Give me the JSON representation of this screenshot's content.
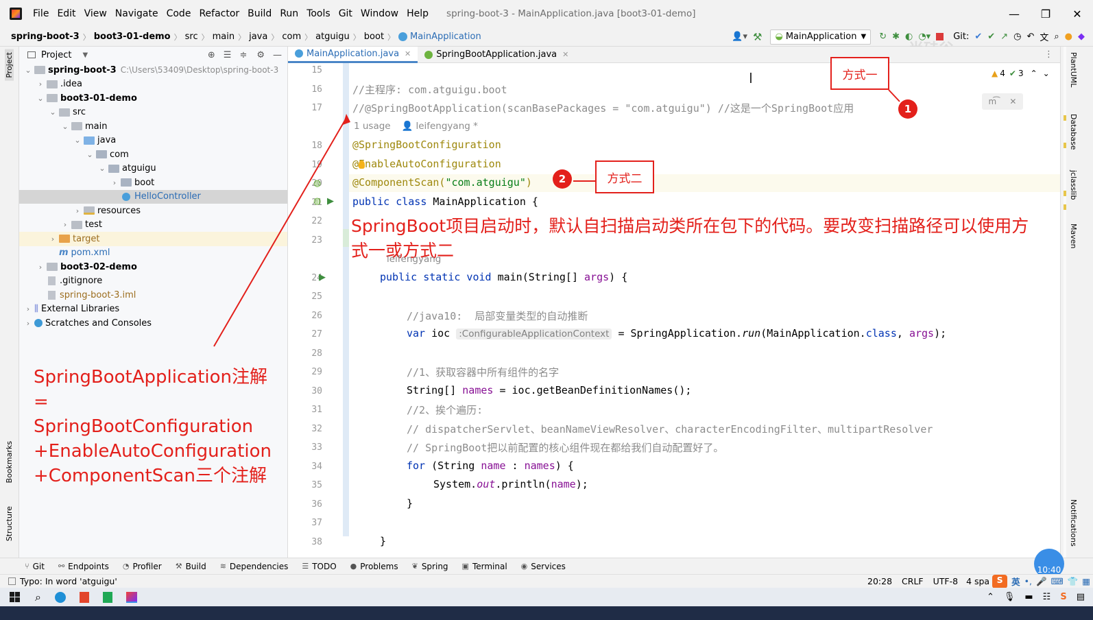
{
  "menubar": {
    "items": [
      "File",
      "Edit",
      "View",
      "Navigate",
      "Code",
      "Refactor",
      "Build",
      "Run",
      "Tools",
      "Git",
      "Window",
      "Help"
    ],
    "window_title": "spring-boot-3 - MainApplication.java [boot3-01-demo]"
  },
  "navbar": {
    "breadcrumbs": [
      "spring-boot-3",
      "boot3-01-demo",
      "src",
      "main",
      "java",
      "com",
      "atguigu",
      "boot",
      "MainApplication"
    ],
    "run_config": "MainApplication",
    "git_label": "Git:",
    "watermark": "尚硅谷"
  },
  "project_panel": {
    "title": "Project",
    "tree": [
      {
        "label": "spring-boot-3",
        "path": "C:\\Users\\53409\\Desktop\\spring-boot-3",
        "indent": 0,
        "chev": "v",
        "icon": "folder",
        "bold": true
      },
      {
        "label": ".idea",
        "indent": 1,
        "chev": ">",
        "icon": "folder"
      },
      {
        "label": "boot3-01-demo",
        "indent": 1,
        "chev": "v",
        "icon": "folder",
        "bold": true
      },
      {
        "label": "src",
        "indent": 2,
        "chev": "v",
        "icon": "folder"
      },
      {
        "label": "main",
        "indent": 3,
        "chev": "v",
        "icon": "folder"
      },
      {
        "label": "java",
        "indent": 4,
        "chev": "v",
        "icon": "folder-blue"
      },
      {
        "label": "com",
        "indent": 5,
        "chev": "v",
        "icon": "package"
      },
      {
        "label": "atguigu",
        "indent": 6,
        "chev": "v",
        "icon": "package"
      },
      {
        "label": "boot",
        "indent": 7,
        "chev": ">",
        "icon": "package"
      },
      {
        "label": "HelloController",
        "indent": 7,
        "chev": "",
        "icon": "class",
        "selected": true
      },
      {
        "label": "resources",
        "indent": 4,
        "chev": ">",
        "icon": "folder-res"
      },
      {
        "label": "test",
        "indent": 3,
        "chev": ">",
        "icon": "folder"
      },
      {
        "label": "target",
        "indent": 2,
        "chev": ">",
        "icon": "folder-orange",
        "excluded": true
      },
      {
        "label": "pom.xml",
        "indent": 2,
        "chev": "",
        "icon": "maven"
      },
      {
        "label": "boot3-02-demo",
        "indent": 1,
        "chev": ">",
        "icon": "folder",
        "bold": true
      },
      {
        "label": ".gitignore",
        "indent": 1,
        "chev": "",
        "icon": "file"
      },
      {
        "label": "spring-boot-3.iml",
        "indent": 1,
        "chev": "",
        "icon": "file"
      },
      {
        "label": "External Libraries",
        "indent": 0,
        "chev": ">",
        "icon": "libs"
      },
      {
        "label": "Scratches and Consoles",
        "indent": 0,
        "chev": ">",
        "icon": "scratch"
      }
    ]
  },
  "left_strip": {
    "project": "Project",
    "bookmarks": "Bookmarks",
    "structure": "Structure"
  },
  "right_strip": {
    "plantuml": "PlantUML",
    "database": "Database",
    "jclasslib": "jclasslib",
    "maven": "Maven",
    "notifications": "Notifications"
  },
  "tabs": [
    {
      "label": "MainApplication.java",
      "active": true
    },
    {
      "label": "SpringBootApplication.java",
      "active": false
    }
  ],
  "inspections": {
    "warnings": "4",
    "ok": "3"
  },
  "editor": {
    "line_numbers": [
      "15",
      "16",
      "17",
      "",
      "18",
      "19",
      "20",
      "21",
      "22",
      "23",
      "",
      "24",
      "25",
      "26",
      "27",
      "28",
      "29",
      "30",
      "31",
      "32",
      "33",
      "34",
      "35",
      "36",
      "37",
      "38"
    ],
    "l16": "//主程序: com.atguigu.boot",
    "l17a": "//@SpringBootApplication(scanBasePackages = ",
    "l17b": "\"com.atguigu\"",
    "l17c": ") //这是一个SpringBoot应用",
    "usage": "1 usage",
    "author": "leifengyang *",
    "author2": "leifengyang",
    "l18": "@SpringBootConfiguration",
    "l19a": "@",
    "l19b": "EnableAutoConfiguration",
    "l20a": "@ComponentScan(",
    "l20b": "\"com.atguigu\"",
    "l20c": ")",
    "l21a": "public class ",
    "l21b": "MainApplication {",
    "l24a": "public static void ",
    "l24b": "main(String[] ",
    "l24c": "args",
    "l24d": ") {",
    "l26": "//java10:  局部变量类型的自动推断",
    "l27a": "var ",
    "l27b": "ioc ",
    "l27hint": ":ConfigurableApplicationContext",
    "l27c": " = SpringApplication.",
    "l27d": "run",
    "l27e": "(MainApplication.",
    "l27f": "class",
    "l27g": ", ",
    "l27h": "args",
    "l27i": ");",
    "l29": "//1、获取容器中所有组件的名字",
    "l30a": "String[] ",
    "l30b": "names",
    "l30c": " = ioc.getBeanDefinitionNames();",
    "l31": "//2、挨个遍历:",
    "l32": "// dispatcherServlet、beanNameViewResolver、characterEncodingFilter、multipartResolver",
    "l33": "// SpringBoot把以前配置的核心组件现在都给我们自动配置好了。",
    "l34a": "for ",
    "l34b": "(String ",
    "l34c": "name",
    "l34d": " : ",
    "l34e": "names",
    "l34f": ") {",
    "l35a": "System.",
    "l35b": "out",
    "l35c": ".println(",
    "l35d": "name",
    "l35e": ");",
    "l36": "}",
    "l38": "}"
  },
  "annotations": {
    "method1": "方式一",
    "method2": "方式二",
    "badge1": "1",
    "badge2": "2",
    "scan_note": "SpringBoot项目启动时，默认自扫描启动类所在包下的代码。要改变扫描路径可以使用方式一或方式二",
    "equation": [
      "SpringBootApplication注解",
      "=",
      "SpringBootConfiguration",
      "+EnableAutoConfiguration",
      "+ComponentScan三个注解"
    ],
    "colors": {
      "annotation": "#e3201b"
    }
  },
  "bottom_tools": [
    "Git",
    "Endpoints",
    "Profiler",
    "Build",
    "Dependencies",
    "TODO",
    "Problems",
    "Spring",
    "Terminal",
    "Services"
  ],
  "status": {
    "message": "Typo: In word 'atguigu'",
    "position": "20:28",
    "line_sep": "CRLF",
    "encoding": "UTF-8",
    "indent": "4 spa",
    "time": "10:40",
    "ime": "英"
  }
}
